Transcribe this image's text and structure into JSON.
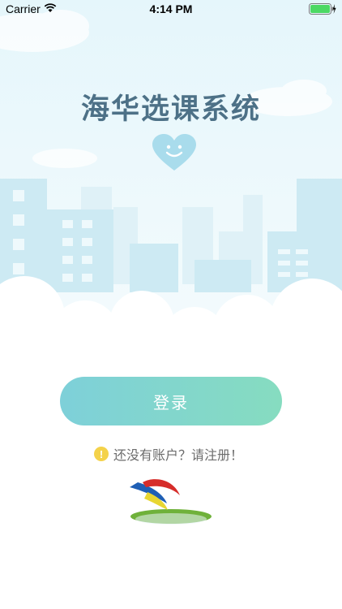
{
  "status_bar": {
    "carrier": "Carrier",
    "time": "4:14 PM"
  },
  "app": {
    "title": "海华选课系统"
  },
  "login": {
    "button_label": "登录"
  },
  "register": {
    "prompt": "还没有账户？请注册！",
    "icon": "!"
  },
  "icons": {
    "wifi": "wifi-icon",
    "battery": "battery-icon",
    "heart": "heart-smile-icon",
    "logo": "school-logo-icon",
    "warning": "warning-icon"
  },
  "colors": {
    "title": "#4d7187",
    "button_start": "#7ed0d9",
    "button_end": "#86dcc0",
    "warning": "#f4d24a",
    "battery": "#4cd964"
  }
}
